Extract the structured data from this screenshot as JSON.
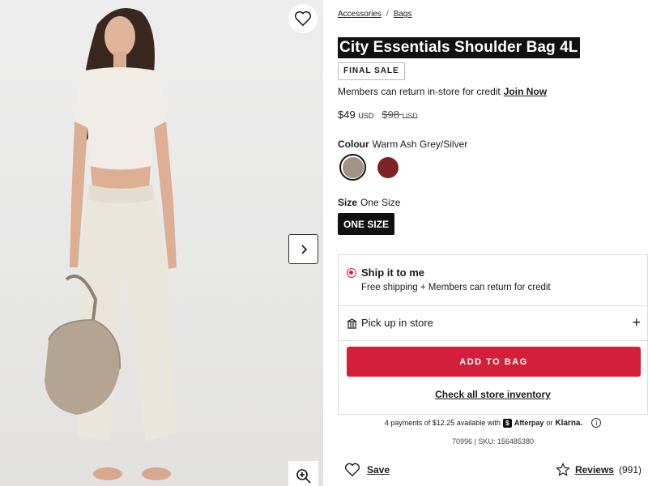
{
  "breadcrumb": {
    "items": [
      "Accessories",
      "Bags"
    ],
    "separator": "/"
  },
  "product": {
    "title": "City Essentials Shoulder Bag 4L",
    "badge": "FINAL SALE",
    "members_note": "Members can return in-store for credit",
    "join_now": "Join Now",
    "price_now": "$49",
    "price_was": "$98",
    "currency": "USD"
  },
  "colour": {
    "label": "Colour",
    "selected_name": "Warm Ash Grey/Silver",
    "swatches": [
      {
        "name": "warm-ash-grey",
        "color": "#a39383",
        "selected": true
      },
      {
        "name": "burgundy",
        "color": "#7d2326",
        "selected": false
      }
    ]
  },
  "size": {
    "label": "Size",
    "selected": "One Size",
    "button": "ONE SIZE"
  },
  "fulfilment": {
    "ship_title": "Ship it to me",
    "ship_sub": "Free shipping + Members can return for credit",
    "pickup": "Pick up in store",
    "add_to_bag": "ADD TO BAG",
    "check_inventory": "Check all store inventory"
  },
  "payments": {
    "text": "4 payments of $12.25 available with",
    "afterpay": "Afterpay",
    "or": "or",
    "klarna": "Klarna."
  },
  "sku_line": "70996 | SKU: 156485380",
  "footer": {
    "save": "Save",
    "reviews_label": "Reviews",
    "reviews_count": "(991)"
  },
  "colors": {
    "accent_red": "#d31f39",
    "black": "#111111"
  }
}
